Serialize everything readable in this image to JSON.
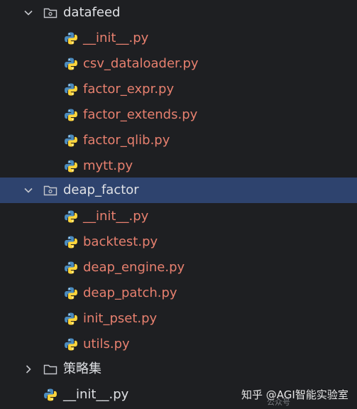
{
  "tree": {
    "datafeed": {
      "name": "datafeed",
      "files": [
        "__init__.py",
        "csv_dataloader.py",
        "factor_expr.py",
        "factor_extends.py",
        "factor_qlib.py",
        "mytt.py"
      ]
    },
    "deap_factor": {
      "name": "deap_factor",
      "files": [
        "__init__.py",
        "backtest.py",
        "deap_engine.py",
        "deap_patch.py",
        "init_pset.py",
        "utils.py"
      ]
    },
    "collapsed_folder": {
      "name": "策略集"
    },
    "root_file": {
      "name": "__init__.py"
    }
  },
  "colors": {
    "background": "#1e1f22",
    "selected_row": "#2e436e",
    "folder_text": "#dfe1e5",
    "py_file_text": "#e7806f"
  },
  "icons": {
    "expanded": "chevron-down-icon",
    "collapsed": "chevron-right-icon",
    "folder": "folder-icon",
    "python": "python-file-icon"
  },
  "watermark": {
    "text": "知乎 @AGI智能实验室",
    "sub": "公众号"
  }
}
